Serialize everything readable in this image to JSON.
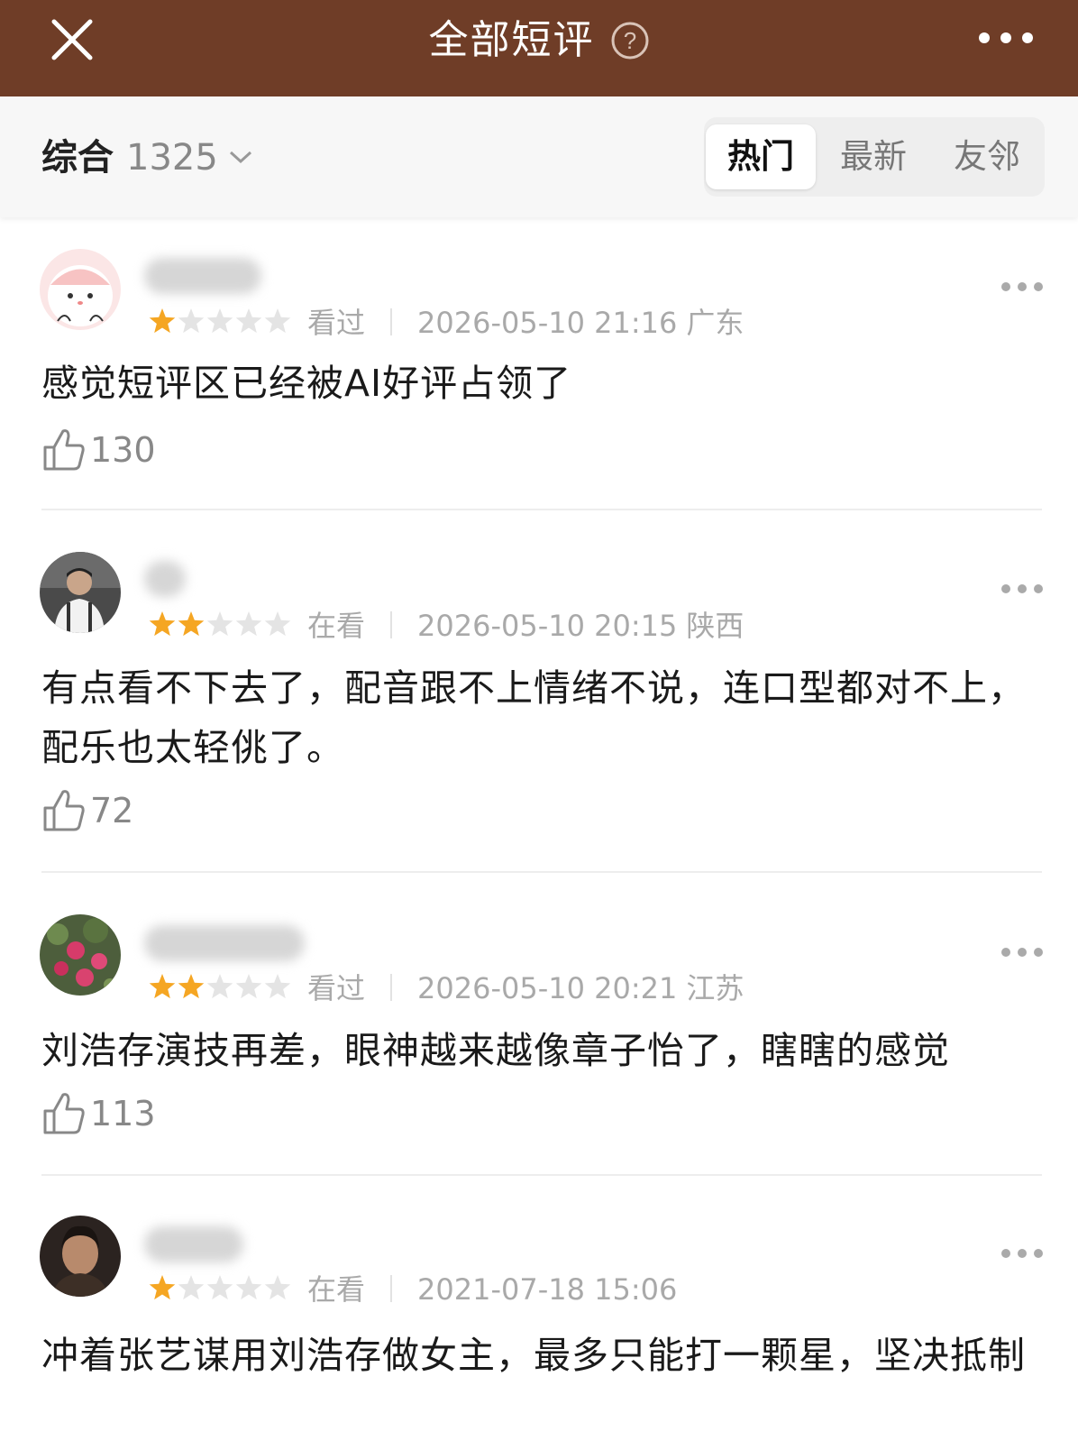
{
  "header": {
    "title": "全部短评",
    "bg_color": "#6f3d27"
  },
  "filter": {
    "sort_label": "综合",
    "count": "1325",
    "tabs": [
      "热门",
      "最新",
      "友邻"
    ],
    "active_tab": "热门"
  },
  "reviews": [
    {
      "rating": 1,
      "status": "看过",
      "datetime": "2026-05-10 21:16",
      "location": "广东",
      "content": "感觉短评区已经被AI好评占领了",
      "likes": "130"
    },
    {
      "rating": 2,
      "status": "在看",
      "datetime": "2026-05-10 20:15",
      "location": "陕西",
      "content": "有点看不下去了，配音跟不上情绪不说，连口型都对不上，配乐也太轻佻了。",
      "likes": "72"
    },
    {
      "rating": 2,
      "status": "看过",
      "datetime": "2026-05-10 20:21",
      "location": "江苏",
      "content": "刘浩存演技再差，眼神越来越像章子怡了，瞎瞎的感觉",
      "likes": "113"
    },
    {
      "rating": 1,
      "status": "在看",
      "datetime": "2021-07-18 15:06",
      "location": "",
      "content": "冲着张艺谋用刘浩存做女主，最多只能打一颗星，坚决抵制",
      "likes": ""
    }
  ],
  "colors": {
    "star_on": "#f5a623",
    "star_off": "#e4e4e4",
    "meta_text": "#a9a9a9"
  }
}
